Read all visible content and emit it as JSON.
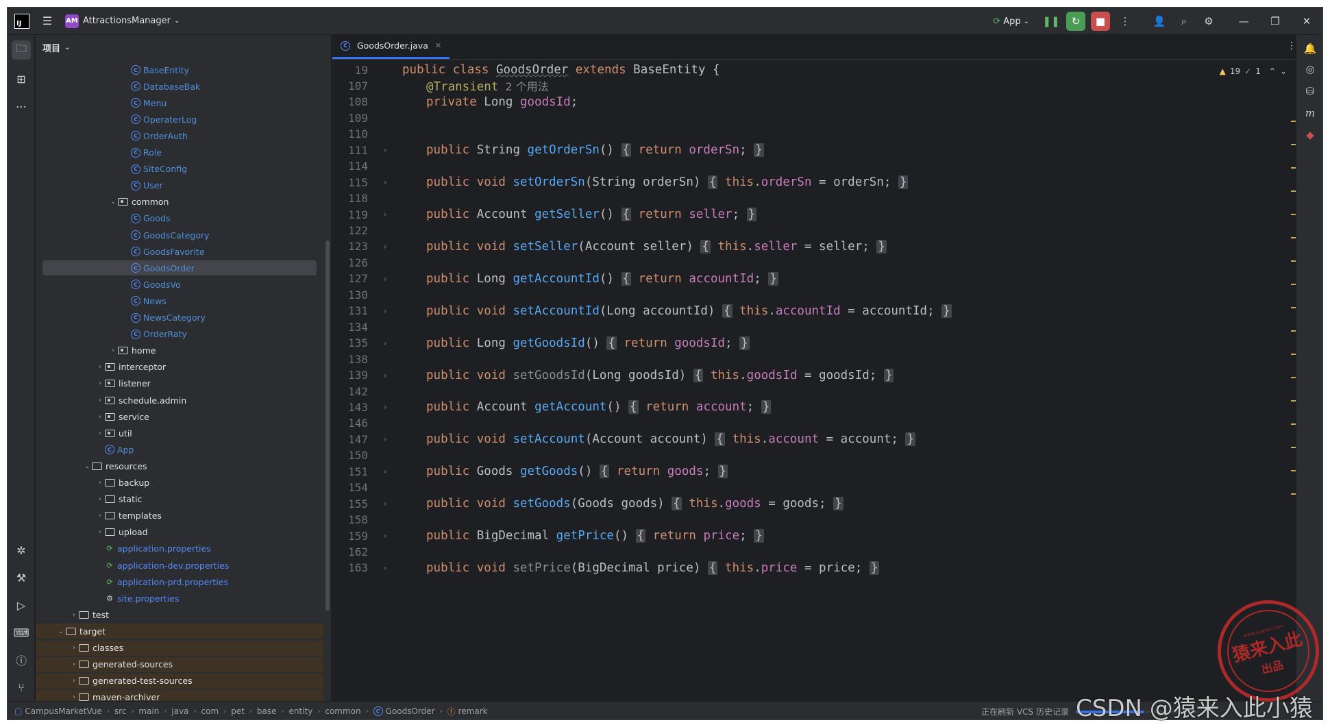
{
  "titlebar": {
    "project_badge": "AM",
    "project_name": "AttractionsManager",
    "run_config": "App"
  },
  "project_panel": {
    "title": "项目",
    "tree": [
      {
        "label": "BaseEntity",
        "type": "class",
        "indent": 5
      },
      {
        "label": "DatabaseBak",
        "type": "class",
        "indent": 5
      },
      {
        "label": "Menu",
        "type": "class",
        "indent": 5
      },
      {
        "label": "OperaterLog",
        "type": "class",
        "indent": 5
      },
      {
        "label": "OrderAuth",
        "type": "class",
        "indent": 5
      },
      {
        "label": "Role",
        "type": "class",
        "indent": 5
      },
      {
        "label": "SiteConfig",
        "type": "class",
        "indent": 5
      },
      {
        "label": "User",
        "type": "class",
        "indent": 5
      },
      {
        "label": "common",
        "type": "package",
        "indent": 4,
        "expanded": true
      },
      {
        "label": "Goods",
        "type": "class",
        "indent": 5
      },
      {
        "label": "GoodsCategory",
        "type": "class",
        "indent": 5
      },
      {
        "label": "GoodsFavorite",
        "type": "class",
        "indent": 5
      },
      {
        "label": "GoodsOrder",
        "type": "class",
        "indent": 5,
        "selected": true
      },
      {
        "label": "GoodsVo",
        "type": "class",
        "indent": 5
      },
      {
        "label": "News",
        "type": "class",
        "indent": 5
      },
      {
        "label": "NewsCategory",
        "type": "class",
        "indent": 5
      },
      {
        "label": "OrderRaty",
        "type": "class",
        "indent": 5
      },
      {
        "label": "home",
        "type": "package",
        "indent": 4,
        "expanded": false
      },
      {
        "label": "interceptor",
        "type": "package",
        "indent": 3,
        "expanded": false
      },
      {
        "label": "listener",
        "type": "package",
        "indent": 3,
        "expanded": false
      },
      {
        "label": "schedule.admin",
        "type": "package",
        "indent": 3,
        "expanded": false
      },
      {
        "label": "service",
        "type": "package",
        "indent": 3,
        "expanded": false
      },
      {
        "label": "util",
        "type": "package",
        "indent": 3,
        "expanded": false
      },
      {
        "label": "App",
        "type": "app",
        "indent": 3
      },
      {
        "label": "resources",
        "type": "folder",
        "indent": 2,
        "expanded": true
      },
      {
        "label": "backup",
        "type": "folder",
        "indent": 3,
        "expanded": false
      },
      {
        "label": "static",
        "type": "folder",
        "indent": 3,
        "expanded": false
      },
      {
        "label": "templates",
        "type": "folder",
        "indent": 3,
        "expanded": false
      },
      {
        "label": "upload",
        "type": "folder",
        "indent": 3,
        "expanded": false
      },
      {
        "label": "application.properties",
        "type": "props",
        "indent": 3
      },
      {
        "label": "application-dev.properties",
        "type": "props",
        "indent": 3
      },
      {
        "label": "application-prd.properties",
        "type": "props",
        "indent": 3
      },
      {
        "label": "site.properties",
        "type": "settings",
        "indent": 3
      },
      {
        "label": "test",
        "type": "folder",
        "indent": 1,
        "expanded": false
      },
      {
        "label": "target",
        "type": "folder",
        "indent": 0,
        "expanded": true,
        "excluded": true
      },
      {
        "label": "classes",
        "type": "folder",
        "indent": 1,
        "expanded": false,
        "excluded": true
      },
      {
        "label": "generated-sources",
        "type": "folder",
        "indent": 1,
        "expanded": false,
        "excluded": true
      },
      {
        "label": "generated-test-sources",
        "type": "folder",
        "indent": 1,
        "expanded": false,
        "excluded": true
      },
      {
        "label": "maven-archiver",
        "type": "folder",
        "indent": 1,
        "expanded": false,
        "excluded": true
      }
    ]
  },
  "editor": {
    "tab_label": "GoodsOrder.java",
    "inspections": {
      "warnings": "19",
      "ok": "1"
    },
    "lines": [
      {
        "num": "19",
        "fold": false,
        "parts": [
          [
            "kw",
            "public "
          ],
          [
            "kw",
            "class "
          ],
          [
            "und",
            "GoodsOrder"
          ],
          [
            "kw",
            " extends "
          ],
          [
            "src",
            "BaseEntity {"
          ]
        ],
        "indent": 0
      },
      {
        "num": "107",
        "fold": false,
        "parts": [
          [
            "ann",
            "@Transient"
          ],
          [
            "hint",
            "  2 个用法"
          ]
        ],
        "indent": 1
      },
      {
        "num": "108",
        "fold": false,
        "parts": [
          [
            "kw",
            "private "
          ],
          [
            "src",
            "Long "
          ],
          [
            "fld",
            "goodsId"
          ],
          [
            "src",
            ";"
          ]
        ],
        "indent": 1
      },
      {
        "num": "109",
        "fold": false,
        "parts": [],
        "indent": 1
      },
      {
        "num": "110",
        "fold": false,
        "parts": [],
        "indent": 1
      },
      {
        "num": "111",
        "fold": true,
        "parts": [
          [
            "kw",
            "public "
          ],
          [
            "src",
            "String "
          ],
          [
            "fn",
            "getOrderSn"
          ],
          [
            "src",
            "() "
          ],
          [
            "br",
            "{"
          ],
          [
            "src",
            " "
          ],
          [
            "kw",
            "return "
          ],
          [
            "fld",
            "orderSn"
          ],
          [
            "src",
            "; "
          ],
          [
            "br",
            "}"
          ]
        ],
        "indent": 1
      },
      {
        "num": "114",
        "fold": false,
        "parts": [],
        "indent": 1
      },
      {
        "num": "115",
        "fold": true,
        "parts": [
          [
            "kw",
            "public "
          ],
          [
            "kw",
            "void "
          ],
          [
            "fn",
            "setOrderSn"
          ],
          [
            "src",
            "(String orderSn) "
          ],
          [
            "br",
            "{"
          ],
          [
            "src",
            " "
          ],
          [
            "kw",
            "this"
          ],
          [
            "src",
            "."
          ],
          [
            "fld",
            "orderSn"
          ],
          [
            "src",
            " = orderSn; "
          ],
          [
            "br",
            "}"
          ]
        ],
        "indent": 1
      },
      {
        "num": "118",
        "fold": false,
        "parts": [],
        "indent": 1
      },
      {
        "num": "119",
        "fold": true,
        "parts": [
          [
            "kw",
            "public "
          ],
          [
            "src",
            "Account "
          ],
          [
            "fn",
            "getSeller"
          ],
          [
            "src",
            "() "
          ],
          [
            "br",
            "{"
          ],
          [
            "src",
            " "
          ],
          [
            "kw",
            "return "
          ],
          [
            "fld",
            "seller"
          ],
          [
            "src",
            "; "
          ],
          [
            "br",
            "}"
          ]
        ],
        "indent": 1
      },
      {
        "num": "122",
        "fold": false,
        "parts": [],
        "indent": 1
      },
      {
        "num": "123",
        "fold": true,
        "parts": [
          [
            "kw",
            "public "
          ],
          [
            "kw",
            "void "
          ],
          [
            "fn",
            "setSeller"
          ],
          [
            "src",
            "(Account seller) "
          ],
          [
            "br",
            "{"
          ],
          [
            "src",
            " "
          ],
          [
            "kw",
            "this"
          ],
          [
            "src",
            "."
          ],
          [
            "fld",
            "seller"
          ],
          [
            "src",
            " = seller; "
          ],
          [
            "br",
            "}"
          ]
        ],
        "indent": 1
      },
      {
        "num": "126",
        "fold": false,
        "parts": [],
        "indent": 1
      },
      {
        "num": "127",
        "fold": true,
        "parts": [
          [
            "kw",
            "public "
          ],
          [
            "src",
            "Long "
          ],
          [
            "fn",
            "getAccountId"
          ],
          [
            "src",
            "() "
          ],
          [
            "br",
            "{"
          ],
          [
            "src",
            " "
          ],
          [
            "kw",
            "return "
          ],
          [
            "fld",
            "accountId"
          ],
          [
            "src",
            "; "
          ],
          [
            "br",
            "}"
          ]
        ],
        "indent": 1
      },
      {
        "num": "130",
        "fold": false,
        "parts": [],
        "indent": 1
      },
      {
        "num": "131",
        "fold": true,
        "parts": [
          [
            "kw",
            "public "
          ],
          [
            "kw",
            "void "
          ],
          [
            "fn",
            "setAccountId"
          ],
          [
            "src",
            "(Long accountId) "
          ],
          [
            "br",
            "{"
          ],
          [
            "src",
            " "
          ],
          [
            "kw",
            "this"
          ],
          [
            "src",
            "."
          ],
          [
            "fld",
            "accountId"
          ],
          [
            "src",
            " = accountId; "
          ],
          [
            "br",
            "}"
          ]
        ],
        "indent": 1
      },
      {
        "num": "134",
        "fold": false,
        "parts": [],
        "indent": 1
      },
      {
        "num": "135",
        "fold": true,
        "parts": [
          [
            "kw",
            "public "
          ],
          [
            "src",
            "Long "
          ],
          [
            "fn",
            "getGoodsId"
          ],
          [
            "src",
            "() "
          ],
          [
            "br",
            "{"
          ],
          [
            "src",
            " "
          ],
          [
            "kw",
            "return "
          ],
          [
            "fld",
            "goodsId"
          ],
          [
            "src",
            "; "
          ],
          [
            "br",
            "}"
          ]
        ],
        "indent": 1
      },
      {
        "num": "138",
        "fold": false,
        "parts": [],
        "indent": 1
      },
      {
        "num": "139",
        "fold": true,
        "parts": [
          [
            "kw",
            "public "
          ],
          [
            "kw",
            "void "
          ],
          [
            "dim",
            "setGoodsId"
          ],
          [
            "src",
            "(Long goodsId) "
          ],
          [
            "br",
            "{"
          ],
          [
            "src",
            " "
          ],
          [
            "kw",
            "this"
          ],
          [
            "src",
            "."
          ],
          [
            "fld",
            "goodsId"
          ],
          [
            "src",
            " = goodsId; "
          ],
          [
            "br",
            "}"
          ]
        ],
        "indent": 1
      },
      {
        "num": "142",
        "fold": false,
        "parts": [],
        "indent": 1
      },
      {
        "num": "143",
        "fold": true,
        "parts": [
          [
            "kw",
            "public "
          ],
          [
            "src",
            "Account "
          ],
          [
            "fn",
            "getAccount"
          ],
          [
            "src",
            "() "
          ],
          [
            "br",
            "{"
          ],
          [
            "src",
            " "
          ],
          [
            "kw",
            "return "
          ],
          [
            "fld",
            "account"
          ],
          [
            "src",
            "; "
          ],
          [
            "br",
            "}"
          ]
        ],
        "indent": 1
      },
      {
        "num": "146",
        "fold": false,
        "parts": [],
        "indent": 1
      },
      {
        "num": "147",
        "fold": true,
        "parts": [
          [
            "kw",
            "public "
          ],
          [
            "kw",
            "void "
          ],
          [
            "fn",
            "setAccount"
          ],
          [
            "src",
            "(Account account) "
          ],
          [
            "br",
            "{"
          ],
          [
            "src",
            " "
          ],
          [
            "kw",
            "this"
          ],
          [
            "src",
            "."
          ],
          [
            "fld",
            "account"
          ],
          [
            "src",
            " = account; "
          ],
          [
            "br",
            "}"
          ]
        ],
        "indent": 1
      },
      {
        "num": "150",
        "fold": false,
        "parts": [],
        "indent": 1
      },
      {
        "num": "151",
        "fold": true,
        "parts": [
          [
            "kw",
            "public "
          ],
          [
            "src",
            "Goods "
          ],
          [
            "fn",
            "getGoods"
          ],
          [
            "src",
            "() "
          ],
          [
            "br",
            "{"
          ],
          [
            "src",
            " "
          ],
          [
            "kw",
            "return "
          ],
          [
            "fld",
            "goods"
          ],
          [
            "src",
            "; "
          ],
          [
            "br",
            "}"
          ]
        ],
        "indent": 1
      },
      {
        "num": "154",
        "fold": false,
        "parts": [],
        "indent": 1
      },
      {
        "num": "155",
        "fold": true,
        "parts": [
          [
            "kw",
            "public "
          ],
          [
            "kw",
            "void "
          ],
          [
            "fn",
            "setGoods"
          ],
          [
            "src",
            "(Goods goods) "
          ],
          [
            "br",
            "{"
          ],
          [
            "src",
            " "
          ],
          [
            "kw",
            "this"
          ],
          [
            "src",
            "."
          ],
          [
            "fld",
            "goods"
          ],
          [
            "src",
            " = goods; "
          ],
          [
            "br",
            "}"
          ]
        ],
        "indent": 1
      },
      {
        "num": "158",
        "fold": false,
        "parts": [],
        "indent": 1
      },
      {
        "num": "159",
        "fold": true,
        "parts": [
          [
            "kw",
            "public "
          ],
          [
            "src",
            "BigDecimal "
          ],
          [
            "fn",
            "getPrice"
          ],
          [
            "src",
            "() "
          ],
          [
            "br",
            "{"
          ],
          [
            "src",
            " "
          ],
          [
            "kw",
            "return "
          ],
          [
            "fld",
            "price"
          ],
          [
            "src",
            "; "
          ],
          [
            "br",
            "}"
          ]
        ],
        "indent": 1
      },
      {
        "num": "162",
        "fold": false,
        "parts": [],
        "indent": 1
      },
      {
        "num": "163",
        "fold": true,
        "parts": [
          [
            "kw",
            "public "
          ],
          [
            "kw",
            "void "
          ],
          [
            "dim",
            "setPrice"
          ],
          [
            "src",
            "(BigDecimal price) "
          ],
          [
            "br",
            "{"
          ],
          [
            "src",
            " "
          ],
          [
            "kw",
            "this"
          ],
          [
            "src",
            "."
          ],
          [
            "fld",
            "price"
          ],
          [
            "src",
            " = price; "
          ],
          [
            "br",
            "}"
          ]
        ],
        "indent": 1
      }
    ]
  },
  "statusbar": {
    "breadcrumbs": [
      "CampusMarketVue",
      "src",
      "main",
      "java",
      "com",
      "pet",
      "base",
      "entity",
      "common",
      "GoodsOrder",
      "remark"
    ],
    "task_text": "正在刷新 VCS 历史记录",
    "progress": 0.55
  },
  "watermark": {
    "csdn": "CSDN @猿来入此小猿",
    "stamp_main": "猿来入此",
    "stamp_sub": "出品",
    "stamp_url": "www.yuanrc.com"
  },
  "icons": {
    "left_strip": [
      "folder-icon",
      "structure-icon",
      "more-icon",
      "debug-icon",
      "build-icon",
      "run-icon",
      "terminal-icon",
      "problems-icon",
      "git-icon"
    ],
    "right_strip": [
      "notifications-icon",
      "ai-assistant-icon",
      "database-icon",
      "maven-icon",
      "plugin-icon"
    ]
  }
}
